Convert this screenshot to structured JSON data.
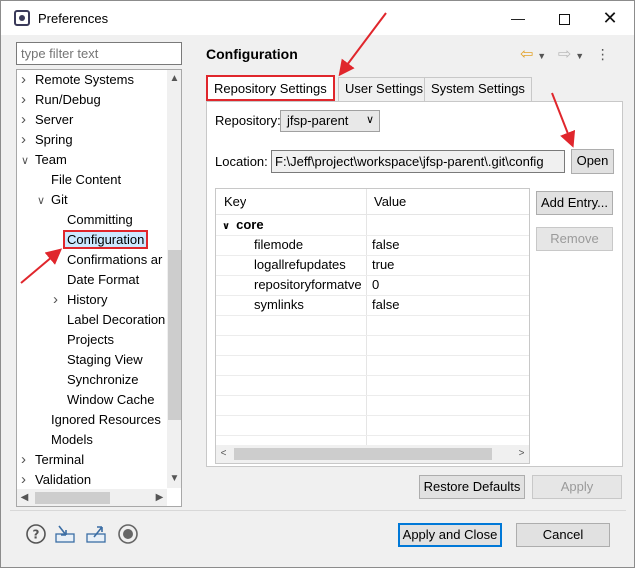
{
  "window": {
    "title": "Preferences",
    "minimize": "—",
    "close": "✕"
  },
  "filter": {
    "placeholder": "type filter text"
  },
  "tree": {
    "items": [
      {
        "label": "Remote Systems",
        "twisty": ">"
      },
      {
        "label": "Run/Debug",
        "twisty": ">"
      },
      {
        "label": "Server",
        "twisty": ">"
      },
      {
        "label": "Spring",
        "twisty": ">"
      },
      {
        "label": "Team",
        "twisty": "v"
      },
      {
        "label": "File Content",
        "twisty": ""
      },
      {
        "label": "Git",
        "twisty": "v"
      },
      {
        "label": "Committing",
        "twisty": ""
      },
      {
        "label": "Configuration",
        "twisty": "",
        "selected": true
      },
      {
        "label": "Confirmations ar",
        "twisty": ""
      },
      {
        "label": "Date Format",
        "twisty": ""
      },
      {
        "label": "History",
        "twisty": ">"
      },
      {
        "label": "Label Decoration",
        "twisty": ""
      },
      {
        "label": "Projects",
        "twisty": ""
      },
      {
        "label": "Staging View",
        "twisty": ""
      },
      {
        "label": "Synchronize",
        "twisty": ""
      },
      {
        "label": "Window Cache",
        "twisty": ""
      },
      {
        "label": "Ignored Resources",
        "twisty": ""
      },
      {
        "label": "Models",
        "twisty": ""
      },
      {
        "label": "Terminal",
        "twisty": ">"
      },
      {
        "label": "Validation",
        "twisty": ">"
      }
    ]
  },
  "page": {
    "title": "Configuration"
  },
  "tabs": [
    "Repository Settings",
    "User Settings",
    "System Settings"
  ],
  "repository": {
    "label": "Repository:",
    "value": "jfsp-parent"
  },
  "location": {
    "label": "Location:",
    "value": "F:\\Jeff\\project\\workspace\\jfsp-parent\\.git\\config",
    "open_label": "Open"
  },
  "table": {
    "columns": [
      "Key",
      "Value"
    ],
    "section": "core",
    "rows": [
      {
        "key": "filemode",
        "value": "false"
      },
      {
        "key": "logallrefupdates",
        "value": "true"
      },
      {
        "key": "repositoryformatve",
        "value": "0"
      },
      {
        "key": "symlinks",
        "value": "false"
      }
    ]
  },
  "side_buttons": {
    "add": "Add Entry...",
    "remove": "Remove"
  },
  "footer": {
    "restore": "Restore Defaults",
    "apply": "Apply",
    "apply_close": "Apply and Close",
    "cancel": "Cancel"
  },
  "colors": {
    "highlight": "#e0262c",
    "default_button": "#0078d7"
  }
}
